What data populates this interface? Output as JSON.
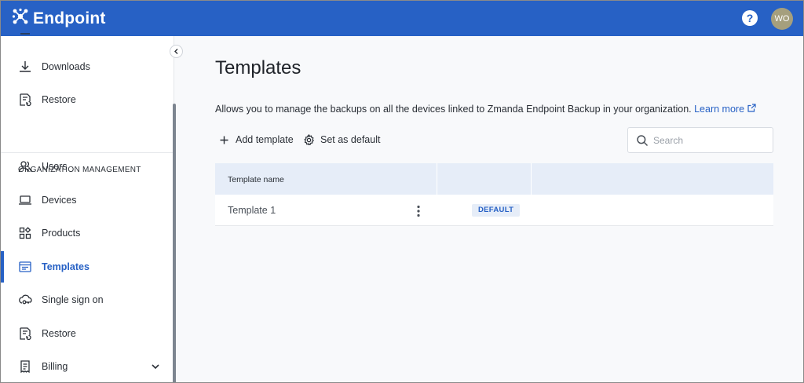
{
  "header": {
    "brand_name": "Endpoint",
    "help_label": "?",
    "avatar_initials": "WO"
  },
  "sidebar": {
    "items_top": [
      {
        "label": "Downloads",
        "icon": "download-icon"
      },
      {
        "label": "Restore",
        "icon": "restore-icon"
      }
    ],
    "section_title": "ORGANIZATION MANAGEMENT",
    "items": [
      {
        "label": "Users",
        "icon": "users-icon"
      },
      {
        "label": "Devices",
        "icon": "laptop-icon"
      },
      {
        "label": "Products",
        "icon": "products-icon"
      },
      {
        "label": "Templates",
        "icon": "template-icon",
        "active": true
      },
      {
        "label": "Single sign on",
        "icon": "cloud-key-icon"
      },
      {
        "label": "Restore",
        "icon": "restore-icon"
      },
      {
        "label": "Billing",
        "icon": "receipt-icon"
      }
    ],
    "accent_color": "#2761c5"
  },
  "main": {
    "title": "Templates",
    "description": "Allows you to manage the backups on all the devices linked to Zmanda Endpoint Backup in your organization.",
    "learn_more": "Learn more",
    "toolbar": {
      "add_label": "Add template",
      "default_label": "Set as default"
    },
    "search": {
      "placeholder": "Search",
      "value": ""
    },
    "table": {
      "columns": [
        "Template name",
        "",
        ""
      ],
      "rows": [
        {
          "name": "Template 1",
          "badge": "DEFAULT"
        }
      ]
    }
  }
}
